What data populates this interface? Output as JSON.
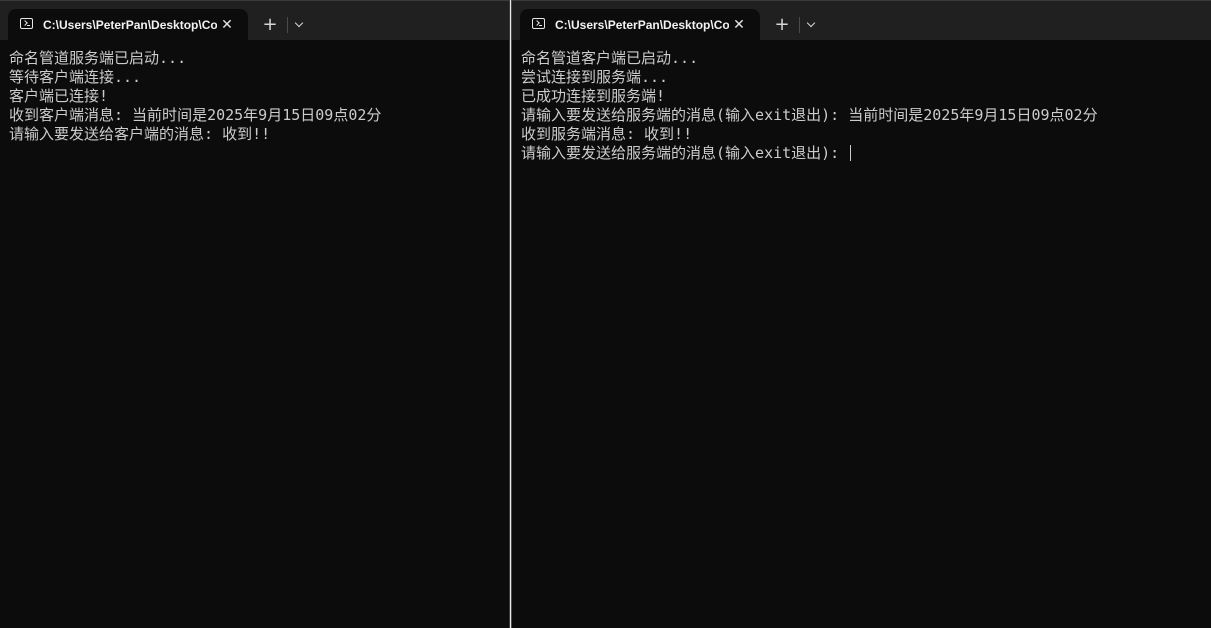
{
  "windows": {
    "left": {
      "tab_title": "C:\\Users\\PeterPan\\Desktop\\Co",
      "close_label": "✕",
      "new_tab_label": "+",
      "lines": [
        "命名管道服务端已启动...",
        "等待客户端连接...",
        "客户端已连接!",
        "收到客户端消息: 当前时间是2025年9月15日09点02分",
        "请输入要发送给客户端的消息: 收到!!"
      ]
    },
    "right": {
      "tab_title": "C:\\Users\\PeterPan\\Desktop\\Co",
      "close_label": "✕",
      "new_tab_label": "+",
      "lines": [
        "命名管道客户端已启动...",
        "尝试连接到服务端...",
        "已成功连接到服务端!",
        "请输入要发送给服务端的消息(输入exit退出): 当前时间是2025年9月15日09点02分",
        "收到服务端消息: 收到!!",
        "请输入要发送给服务端的消息(输入exit退出): "
      ]
    }
  },
  "icons": {
    "tab_icon": "terminal-icon",
    "close_icon": "close-icon",
    "new_tab_icon": "plus-icon",
    "dropdown_icon": "chevron-down-icon"
  },
  "colors": {
    "console_bg": "#0c0c0c",
    "console_text": "#cccccc",
    "titlebar_bg": "#202020"
  }
}
